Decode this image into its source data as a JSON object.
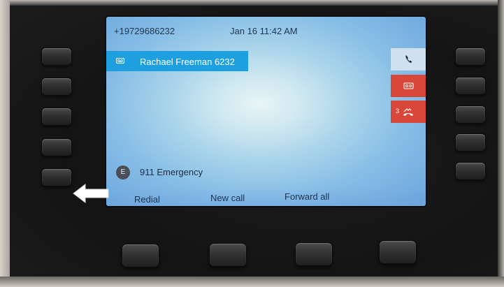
{
  "status_bar": {
    "phone_number": "+19729686232",
    "datetime": "Jan 16 11:42 AM"
  },
  "line": {
    "label": "Rachael Freeman 6232",
    "icon": "voicemail-icon"
  },
  "indicators": {
    "call_icon": "phone-icon",
    "voicemail_icon": "voicemail-icon",
    "missed_icon": "missed-call-icon",
    "missed_count": "3"
  },
  "speed_dial": {
    "avatar_letter": "E",
    "label": "911 Emergency"
  },
  "softkeys": [
    {
      "label": "Redial"
    },
    {
      "label": "New call"
    },
    {
      "label": "Forward all"
    }
  ],
  "colors": {
    "line_highlight": "#1e9fe0",
    "alert_red": "#d9473a",
    "text_dark": "#1f3550"
  }
}
